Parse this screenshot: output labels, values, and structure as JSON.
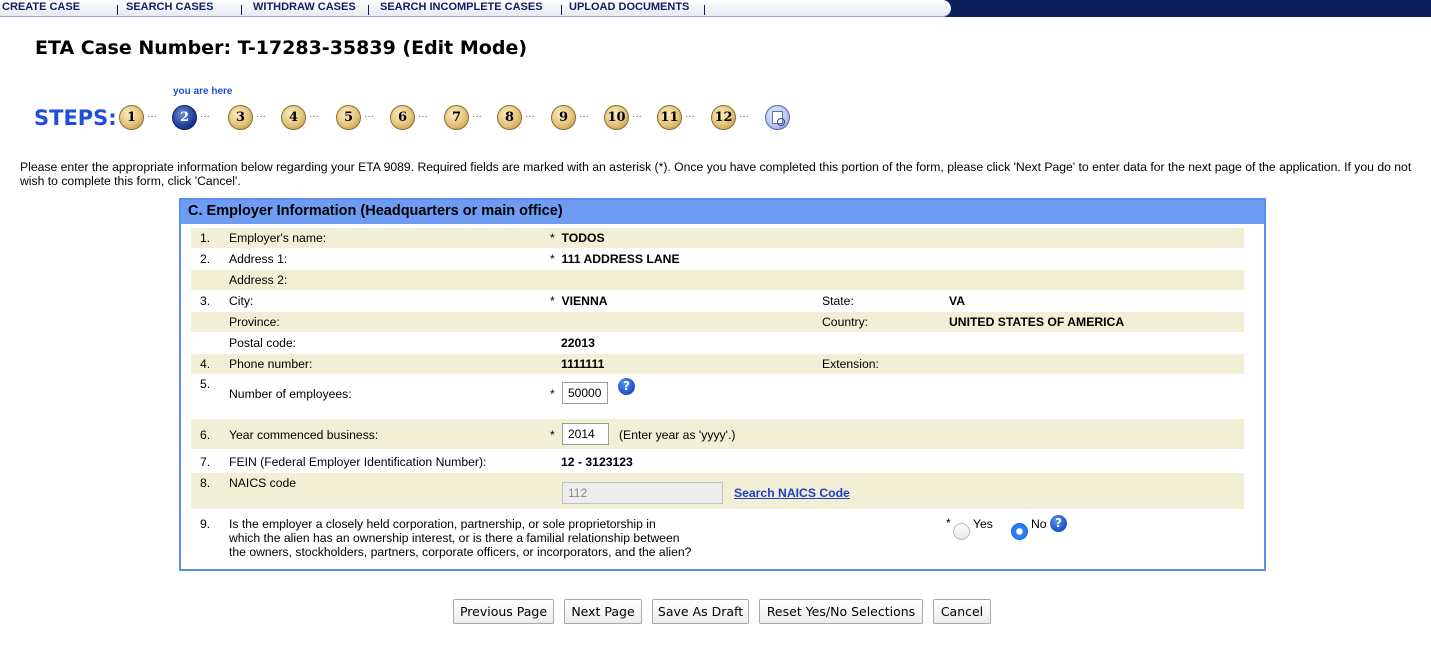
{
  "nav": {
    "items": [
      "CREATE CASE",
      "SEARCH CASES",
      "WITHDRAW CASES",
      "SEARCH INCOMPLETE CASES",
      "UPLOAD DOCUMENTS"
    ]
  },
  "page": {
    "title": "ETA Case Number: T-17283-35839  (Edit Mode)",
    "instructions": "Please enter the appropriate information below regarding your ETA 9089. Required fields are marked with an asterisk (*). Once you have completed this portion of the form, please click 'Next Page' to enter data for the next page of the application. If you do not wish to complete this form, click 'Cancel'."
  },
  "steps": {
    "label": "STEPS:",
    "you_are_here": "you are here",
    "items": [
      "1",
      "2",
      "3",
      "4",
      "5",
      "6",
      "7",
      "8",
      "9",
      "10",
      "11",
      "12"
    ],
    "current": "2",
    "final_icon": "document-review-icon"
  },
  "section": {
    "title": "C. Employer Information (Headquarters or main office)",
    "required_mark": "*",
    "rows": {
      "employer_name": {
        "num": "1.",
        "label": "Employer's name:",
        "value": "TODOS"
      },
      "address1": {
        "num": "2.",
        "label": "Address 1:",
        "value": "111 ADDRESS LANE"
      },
      "address2": {
        "label": "Address 2:",
        "value": ""
      },
      "city": {
        "num": "3.",
        "label": "City:",
        "value": "VIENNA",
        "state_label": "State:",
        "state_value": "VA"
      },
      "province": {
        "label": "Province:",
        "value": "",
        "country_label": "Country:",
        "country_value": "UNITED STATES OF AMERICA"
      },
      "postal": {
        "label": "Postal code:",
        "value": "22013"
      },
      "phone": {
        "num": "4.",
        "label": "Phone number:",
        "value": "1111111",
        "ext_label": "Extension:",
        "ext_value": ""
      },
      "employees": {
        "num": "5.",
        "label": "Number of employees:",
        "value": "50000"
      },
      "year": {
        "num": "6.",
        "label": "Year commenced business:",
        "value": "2014",
        "hint": "(Enter year as 'yyyy'.)"
      },
      "fein": {
        "num": "7.",
        "label": "FEIN (Federal Employer Identification Number):",
        "value": "12 - 3123123"
      },
      "naics": {
        "num": "8.",
        "label": "NAICS code",
        "value": "112",
        "link": "Search NAICS Code"
      },
      "closely_held": {
        "num": "9.",
        "label_line1": "Is the employer a closely held corporation, partnership, or sole proprietorship in",
        "label_line2": "which the alien has an ownership interest, or is there a familial relationship between",
        "label_line3": "the owners, stockholders, partners, corporate officers, or incorporators, and the alien?",
        "yes_label": "Yes",
        "no_label": "No",
        "selected": "No"
      }
    }
  },
  "buttons": {
    "previous": "Previous Page",
    "next": "Next Page",
    "draft": "Save As Draft",
    "reset": "Reset Yes/No Selections",
    "cancel": "Cancel"
  },
  "icons": {
    "help": "help-icon"
  },
  "colors": {
    "nav_bg": "#0d1f5c",
    "panel_header": "#6f9cf3",
    "panel_border": "#5d8ef2",
    "row_shade": "#f1efd5",
    "steps_blue": "#1f4fd6"
  }
}
